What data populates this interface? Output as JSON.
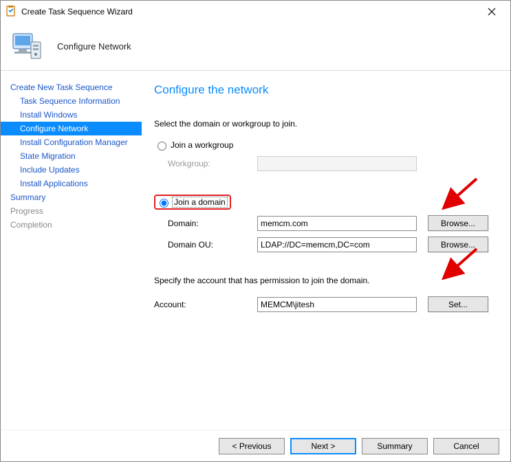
{
  "window": {
    "title": "Create Task Sequence Wizard",
    "header": "Configure Network"
  },
  "sidebar": {
    "group_create": "Create New Task Sequence",
    "items": {
      "tsinfo": "Task Sequence Information",
      "install_windows": "Install Windows",
      "configure_network": "Configure Network",
      "install_cm": "Install Configuration Manager",
      "state_migration": "State Migration",
      "include_updates": "Include Updates",
      "install_apps": "Install Applications"
    },
    "summary": "Summary",
    "progress": "Progress",
    "completion": "Completion"
  },
  "content": {
    "title": "Configure the network",
    "instruction": "Select the domain or workgroup to join.",
    "radio_workgroup": "Join a workgroup",
    "label_workgroup": "Workgroup:",
    "radio_domain": "Join a domain",
    "label_domain": "Domain:",
    "value_domain": "memcm.com",
    "btn_browse": "Browse...",
    "label_domain_ou": "Domain OU:",
    "value_domain_ou": "LDAP://DC=memcm,DC=com",
    "label_account_instruction": "Specify the account that has permission to join the domain.",
    "label_account": "Account:",
    "value_account": "MEMCM\\jitesh",
    "btn_set": "Set..."
  },
  "footer": {
    "previous": "< Previous",
    "next": "Next >",
    "summary": "Summary",
    "cancel": "Cancel"
  }
}
